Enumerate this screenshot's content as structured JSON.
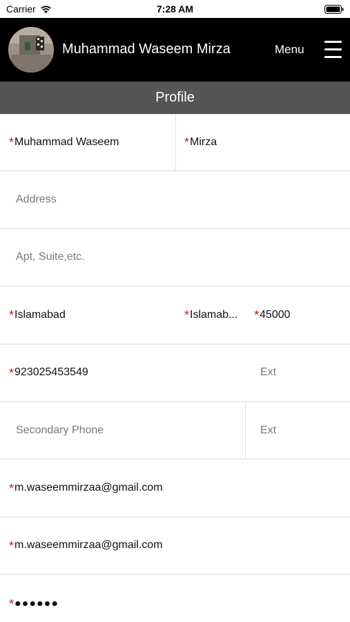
{
  "status_bar": {
    "carrier": "Carrier",
    "time": "7:28 AM",
    "wifi_icon": "wifi-icon",
    "battery_icon": "battery-icon"
  },
  "header": {
    "user_name": "Muhammad Waseem Mirza",
    "menu_label": "Menu",
    "menu_icon": "hamburger-icon",
    "background": "#000000"
  },
  "title_bar": {
    "title": "Profile",
    "background": "#555555"
  },
  "form": {
    "required_marker": "*",
    "required_color": "#dd1111",
    "first_name": "Muhammad Waseem",
    "last_name": "Mirza",
    "address_placeholder": "Address",
    "apt_placeholder": "Apt, Suite,etc.",
    "city": "Islamabad",
    "state": "Islamab...",
    "zip": "45000",
    "primary_phone": "923025453549",
    "primary_ext_placeholder": "Ext",
    "secondary_phone_placeholder": "Secondary Phone",
    "secondary_ext_placeholder": "Ext",
    "email": "m.waseemmirzaa@gmail.com",
    "confirm_email": "m.waseemmirzaa@gmail.com",
    "password_mask": "●●●●●●"
  }
}
